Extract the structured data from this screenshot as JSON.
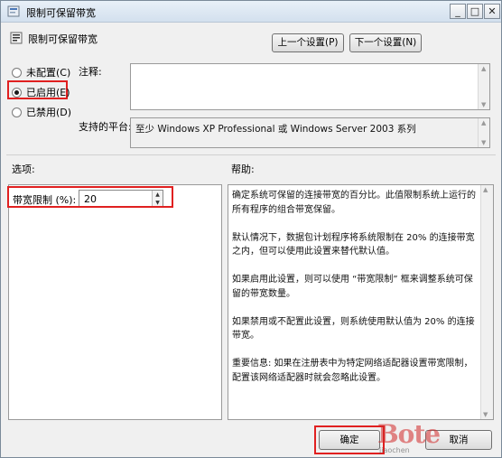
{
  "window": {
    "title": "限制可保留带宽",
    "buttons": {
      "minimize": "_",
      "maximize": "□",
      "close": "✕"
    }
  },
  "header": {
    "title": "限制可保留带宽",
    "prev_button": "上一个设置(P)",
    "next_button": "下一个设置(N)"
  },
  "radio_group": {
    "options": [
      {
        "label": "未配置(C)",
        "selected": false
      },
      {
        "label": "已启用(E)",
        "selected": true
      },
      {
        "label": "已禁用(D)",
        "selected": false
      }
    ]
  },
  "labels": {
    "notes": "注释:",
    "platform": "支持的平台:",
    "options": "选项:",
    "help": "帮助:"
  },
  "notes_value": "",
  "platform_value": "至少 Windows XP Professional 或 Windows Server 2003 系列",
  "options": {
    "bandwidth_label": "带宽限制 (%):",
    "bandwidth_value": "20"
  },
  "help": {
    "paragraphs": [
      "确定系统可保留的连接带宽的百分比。此值限制系统上运行的所有程序的组合带宽保留。",
      "默认情况下，数据包计划程序将系统限制在 20% 的连接带宽之内，但可以使用此设置来替代默认值。",
      "如果启用此设置，则可以使用 “带宽限制” 框来调整系统可保留的带宽数量。",
      "如果禁用或不配置此设置，则系统使用默认值为 20% 的连接带宽。",
      "重要信息: 如果在注册表中为特定网络适配器设置带宽限制，配置该网络适配器时就会忽略此设置。"
    ]
  },
  "footer": {
    "ok": "确定",
    "cancel": "取消"
  },
  "watermark": {
    "logo": "Bote",
    "text": "jiaochen"
  }
}
